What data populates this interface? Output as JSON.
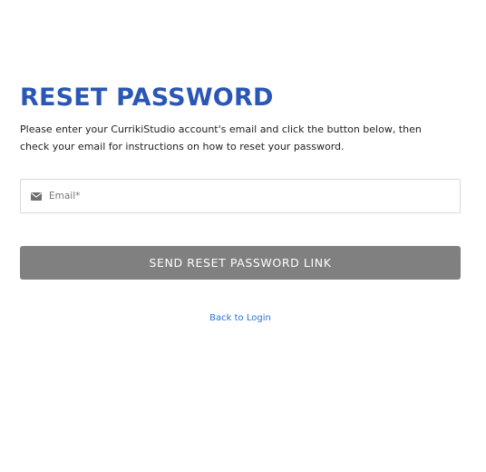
{
  "heading": "RESET PASSWORD",
  "description": "Please enter your CurrikiStudio account's email and click the button below, then check your email for instructions on how to reset your password.",
  "email_field": {
    "icon": "envelope-icon",
    "placeholder": "Email*",
    "value": ""
  },
  "submit_button_label": "SEND RESET PASSWORD LINK",
  "back_link_label": "Back to Login",
  "colors": {
    "heading": "#2a56b6",
    "button_bg": "#808080",
    "link": "#2a72d8"
  }
}
